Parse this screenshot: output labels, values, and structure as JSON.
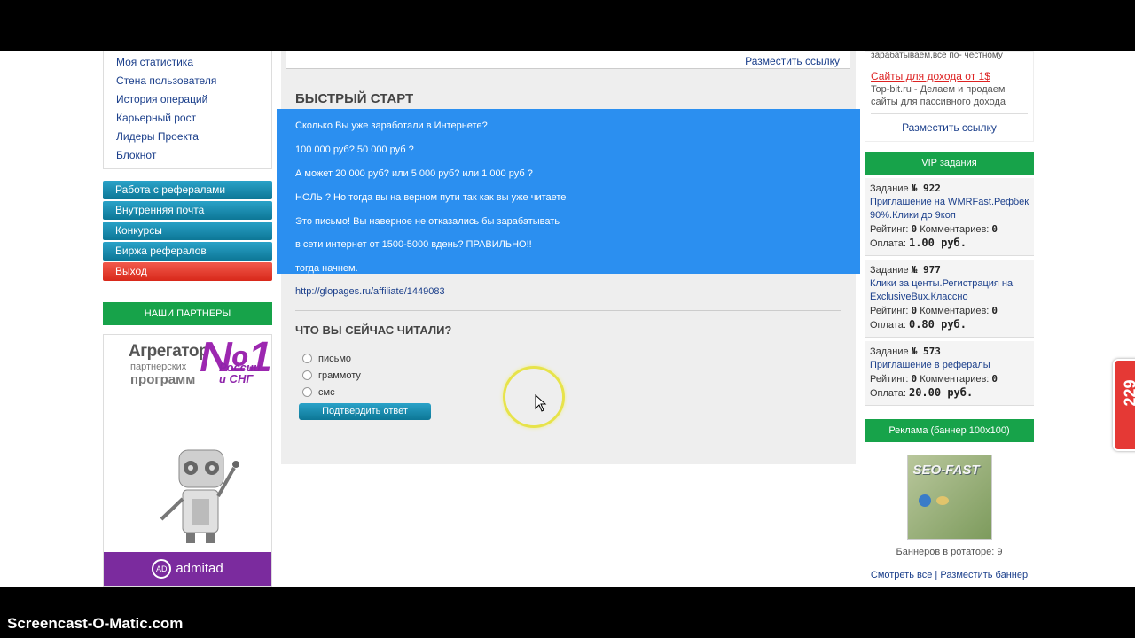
{
  "left_menu": {
    "links": [
      "Моя статистика",
      "Стена пользователя",
      "История операций",
      "Карьерный рост",
      "Лидеры Проекта",
      "Блокнот"
    ],
    "buttons": [
      "Работа с рефералами",
      "Внутренняя почта",
      "Конкурсы",
      "Биржа рефералов"
    ],
    "exit": "Выход"
  },
  "partners": {
    "title": "НАШИ ПАРТНЕРЫ",
    "banner": {
      "line1": "Агрегатор",
      "line2": "партнерских",
      "line3": "программ",
      "number": "№1",
      "russia": "России и СНГ",
      "brand_badge": "AD",
      "brand": "admitad"
    }
  },
  "center": {
    "place_link": "Разместить ссылку",
    "quickstart_title": "БЫСТРЫЙ СТАРТ",
    "lines": [
      "Сколько Вы уже заработали в Интернете?",
      "100 000 руб? 50 000 руб ?",
      "А может 20 000 руб? или 5 000 руб? или 1 000 руб ?",
      "НОЛЬ ? Но тогда вы на верном пути так как вы уже читаете",
      "Это письмо!  Вы наверное не отказались бы зарабатывать",
      "в сети интернет от 1500-5000 вдень?  ПРАВИЛЬНО!!",
      "тогда начнем."
    ],
    "affiliate_link": "http://glopages.ru/affiliate/1449083",
    "question": "ЧТО ВЫ СЕЙЧАС ЧИТАЛИ?",
    "options": [
      "письмо",
      "граммоту",
      "смс"
    ],
    "confirm": "Подтвердить ответ"
  },
  "right": {
    "honest_text": "зарабатываем,все по- честному",
    "ad_title": "Сайты для дохода от 1$",
    "ad_text": "Top-bit.ru - Делаем и продаем сайты для пассивного дохода",
    "place_link": "Разместить ссылку",
    "vip_title": "VIP задания",
    "tasks": [
      {
        "label": "Задание",
        "num": "№ 922",
        "title": "Приглашение на WMRFast.Рефбек 90%.Клики до 9коп",
        "rating_label": "Рейтинг:",
        "rating": "0",
        "comments_label": "Комментариев:",
        "comments": "0",
        "pay_label": "Оплата:",
        "pay": "1.00 руб."
      },
      {
        "label": "Задание",
        "num": "№ 977",
        "title": "Клики за центы.Регистрация на ExclusiveBux.Классно",
        "rating_label": "Рейтинг:",
        "rating": "0",
        "comments_label": "Комментариев:",
        "comments": "0",
        "pay_label": "Оплата:",
        "pay": "0.80 руб."
      },
      {
        "label": "Задание",
        "num": "№ 573",
        "title": "Приглашение в рефералы",
        "rating_label": "Рейтинг:",
        "rating": "0",
        "comments_label": "Комментариев:",
        "comments": "0",
        "pay_label": "Оплата:",
        "pay": "20.00 руб."
      }
    ],
    "banner_title": "Реклама (баннер 100x100)",
    "banner_brand": "SEO-FAST",
    "rotator": "Баннеров в ротаторе: 9",
    "see_all": "Смотреть все",
    "separator": "|",
    "place_banner": "Разместить баннер"
  },
  "side_widget": "229",
  "watermark": "Screencast-O-Matic.com",
  "colors": {
    "accent_blue": "#2b8ff0",
    "green": "#17a34a",
    "teal": "#1a8db3",
    "red": "#e53935",
    "link": "#1b3f8b"
  }
}
